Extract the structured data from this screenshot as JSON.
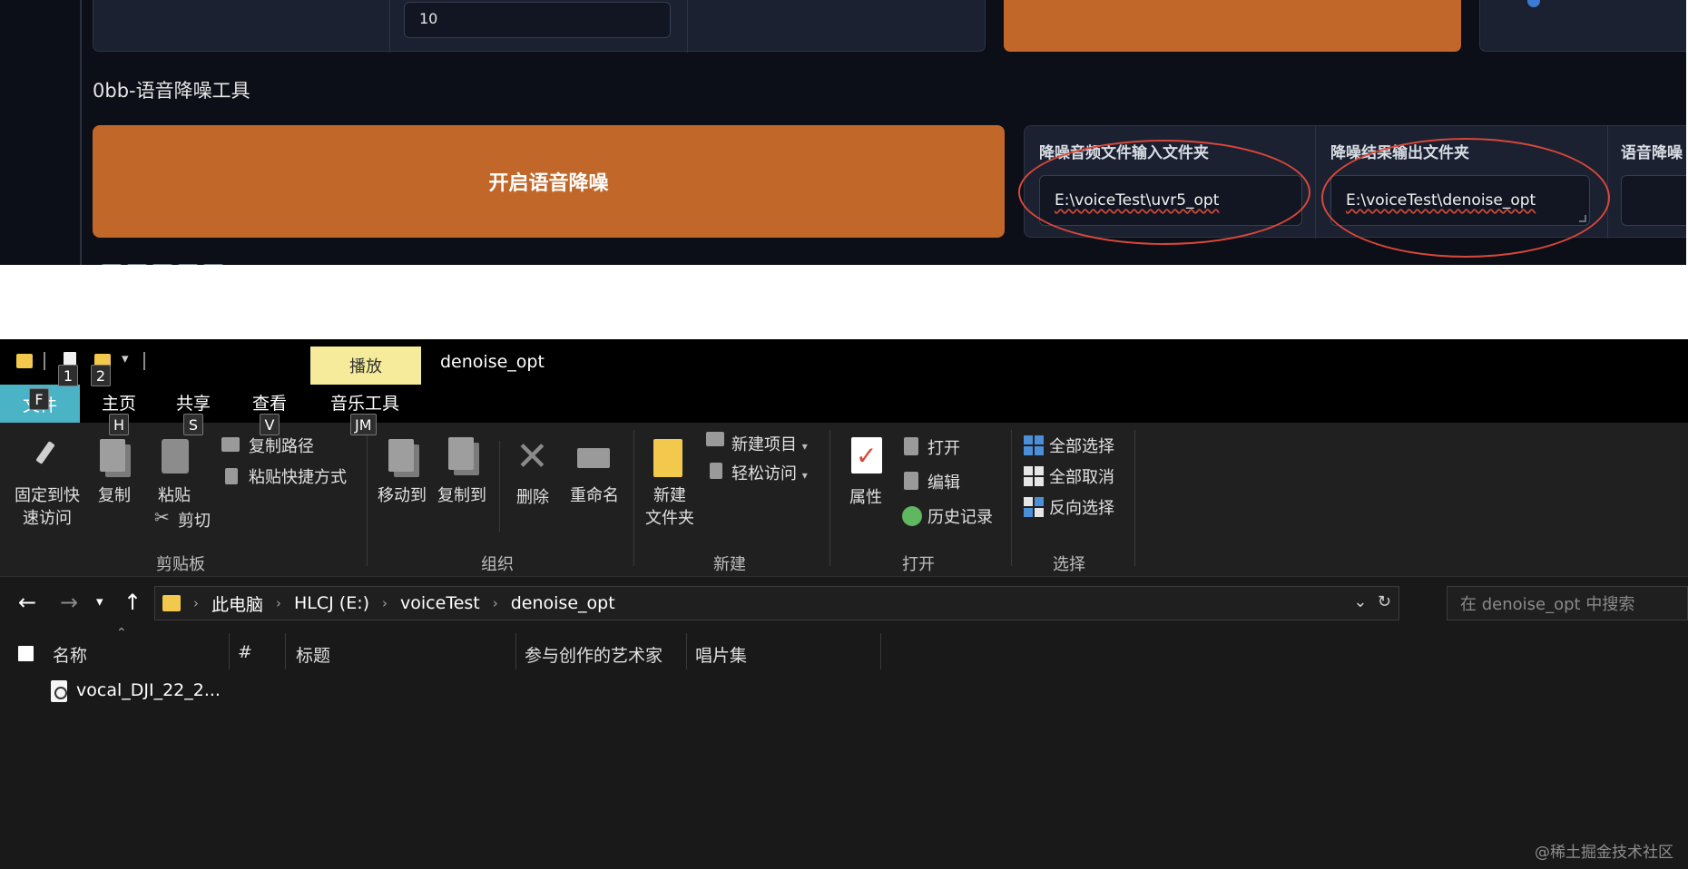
{
  "webui": {
    "top_number_value": "10",
    "section_title": "0bb-语音降噪工具",
    "start_button_label": "开启语音降噪",
    "input_folder_label": "降噪音频文件输入文件夹",
    "input_folder_value": "E:\\voiceTest\\uvr5_opt",
    "output_folder_label": "降噪结果输出文件夹",
    "output_folder_value": "E:\\voiceTest\\denoise_opt",
    "third_label_partial": "语音降噪",
    "accent_color": "#c2672a",
    "annotation_color": "#d9473a"
  },
  "explorer": {
    "play_tab_label": "播放",
    "window_title": "denoise_opt",
    "tabs": {
      "file": "文件",
      "home": "主页",
      "share": "共享",
      "view": "查看",
      "music_tools": "音乐工具"
    },
    "keytips": {
      "qa1": "1",
      "qa2": "2",
      "file": "F",
      "home": "H",
      "share": "S",
      "view": "V",
      "music": "JM"
    },
    "ribbon": {
      "pin_label": "固定到快\n速访问",
      "copy_label": "复制",
      "paste_label": "粘贴",
      "copy_path_label": "复制路径",
      "paste_shortcut_label": "粘贴快捷方式",
      "cut_label": "剪切",
      "clipboard_group": "剪贴板",
      "move_to_label": "移动到",
      "copy_to_label": "复制到",
      "delete_label": "删除",
      "rename_label": "重命名",
      "organize_group": "组织",
      "new_folder_label": "新建\n文件夹",
      "new_item_label": "新建项目",
      "easy_access_label": "轻松访问",
      "new_group": "新建",
      "properties_label": "属性",
      "open_label": "打开",
      "edit_label": "编辑",
      "history_label": "历史记录",
      "open_group": "打开",
      "select_all_label": "全部选择",
      "select_none_label": "全部取消",
      "invert_selection_label": "反向选择",
      "select_group": "选择"
    },
    "address": {
      "crumbs": [
        "此电脑",
        "HLCJ (E:)",
        "voiceTest",
        "denoise_opt"
      ],
      "search_placeholder": "在 denoise_opt 中搜索"
    },
    "columns": {
      "name": "名称",
      "number": "#",
      "title": "标题",
      "artists": "参与创作的艺术家",
      "album": "唱片集"
    },
    "files": [
      {
        "name": "vocal_DJI_22_2..."
      }
    ]
  },
  "watermark": "@稀土掘金技术社区"
}
